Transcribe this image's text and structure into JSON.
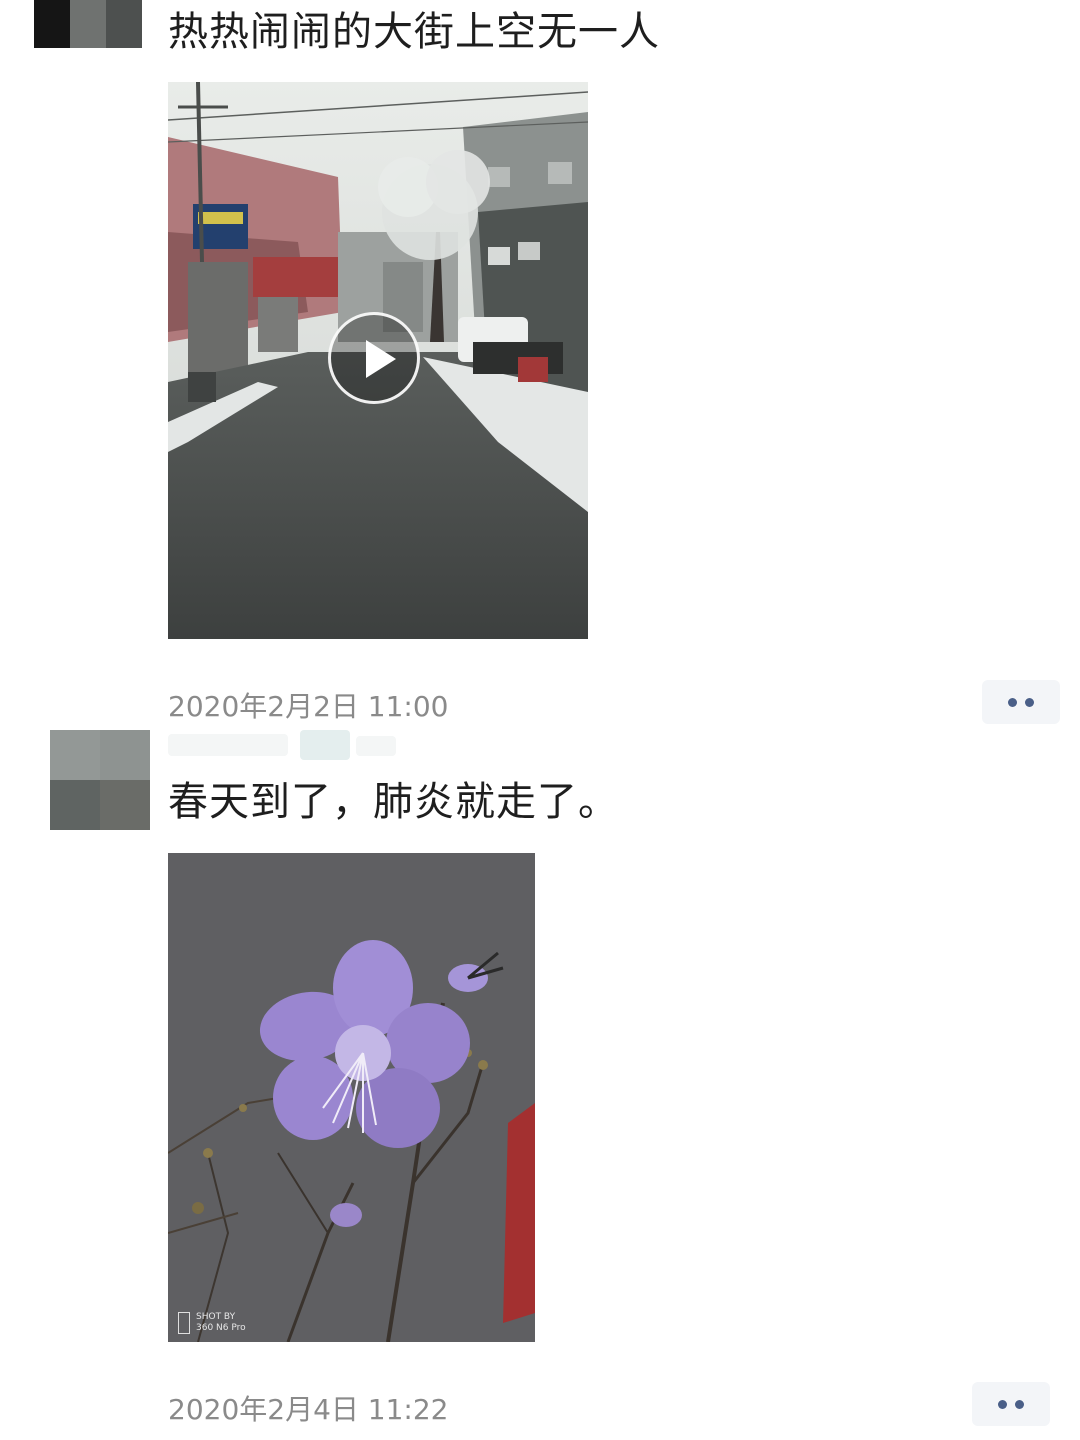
{
  "posts": [
    {
      "text": "热热闹闹的大街上空无一人",
      "media_type": "video",
      "media_icon": "play-icon",
      "timestamp": "2020年2月2日 11:00",
      "more_icon": "more-dots-icon"
    },
    {
      "text": "春天到了，肺炎就走了。",
      "media_type": "photo",
      "watermark": {
        "line1": "SHOT BY",
        "line2": "360 N6 Pro"
      },
      "timestamp": "2020年2月4日 11:22",
      "more_icon": "more-dots-icon"
    }
  ],
  "colors": {
    "background": "#ffffff",
    "text": "#1e1e1e",
    "timestamp": "#8a8a8a",
    "more_button_bg": "#f3f5f8",
    "more_dots": "#4a5f88"
  }
}
